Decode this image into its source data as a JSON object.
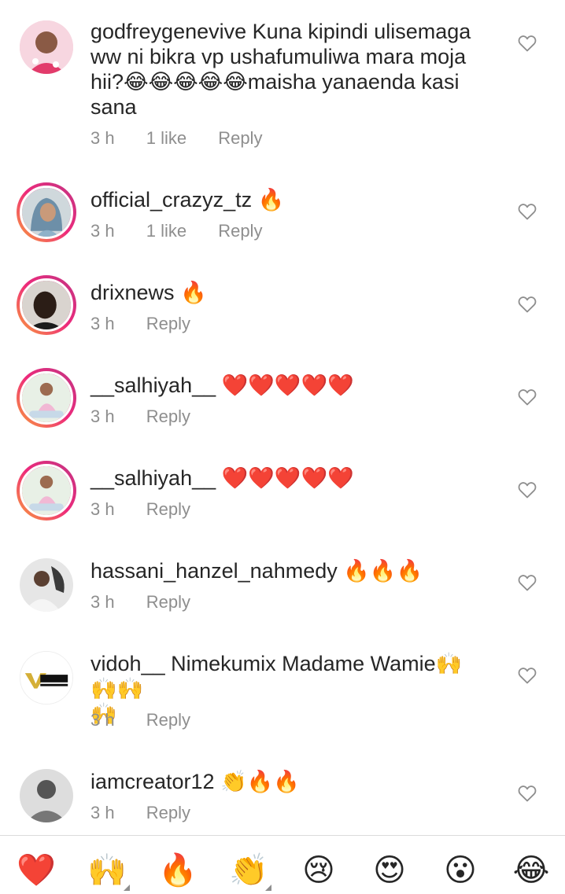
{
  "comments": [
    {
      "username": "godfreygenevive",
      "text_line1": " Kuna kipindi ulisemaga",
      "text_line2": "ww ni bikra vp ushafumuliwa mara moja",
      "text_line3": "hii?😂😂😂😂😂maisha yanaenda kasi",
      "text_line4": "sana",
      "time": "3 h",
      "likes": "1 like",
      "reply": "Reply",
      "has_story_ring": false
    },
    {
      "username": "official_crazyz_tz",
      "text": " 🔥",
      "time": "3 h",
      "likes": "1 like",
      "reply": "Reply",
      "has_story_ring": true
    },
    {
      "username": "drixnews",
      "text": " 🔥",
      "time": "3 h",
      "reply": "Reply",
      "has_story_ring": true
    },
    {
      "username": "__salhiyah__",
      "text": " ❤️❤️❤️❤️❤️",
      "time": "3 h",
      "reply": "Reply",
      "has_story_ring": true
    },
    {
      "username": "__salhiyah__",
      "text": " ❤️❤️❤️❤️❤️",
      "time": "3 h",
      "reply": "Reply",
      "has_story_ring": true
    },
    {
      "username": "hassani_hanzel_nahmedy",
      "text": " 🔥🔥🔥",
      "time": "3 h",
      "reply": "Reply",
      "has_story_ring": false
    },
    {
      "username": "vidoh__",
      "text_line1": " Nimekumix Madame Wamie🙌🙌🙌",
      "text_line2": "🙌",
      "avatar_label": "VIDO BOY",
      "time": "3 h",
      "reply": "Reply",
      "has_story_ring": false
    },
    {
      "username": "iamcreator12",
      "text": " 👏🔥🔥",
      "time": "3 h",
      "reply": "Reply",
      "has_story_ring": false
    }
  ],
  "icons": {
    "like": "heart-outline-icon"
  },
  "reactions": [
    {
      "emoji": "❤️",
      "name": "red-heart"
    },
    {
      "emoji": "🙌",
      "name": "raising-hands"
    },
    {
      "emoji": "🔥",
      "name": "fire"
    },
    {
      "emoji": "👏",
      "name": "clapping-hands"
    },
    {
      "emoji": "😢",
      "name": "crying-face"
    },
    {
      "emoji": "😍",
      "name": "heart-eyes"
    },
    {
      "emoji": "😮",
      "name": "open-mouth"
    },
    {
      "emoji": "😂",
      "name": "tears-of-joy"
    }
  ],
  "colors": {
    "text_primary": "#262626",
    "text_secondary": "#8e8e8e",
    "story_ring_start": "#f9a13a",
    "story_ring_end": "#c13584"
  }
}
